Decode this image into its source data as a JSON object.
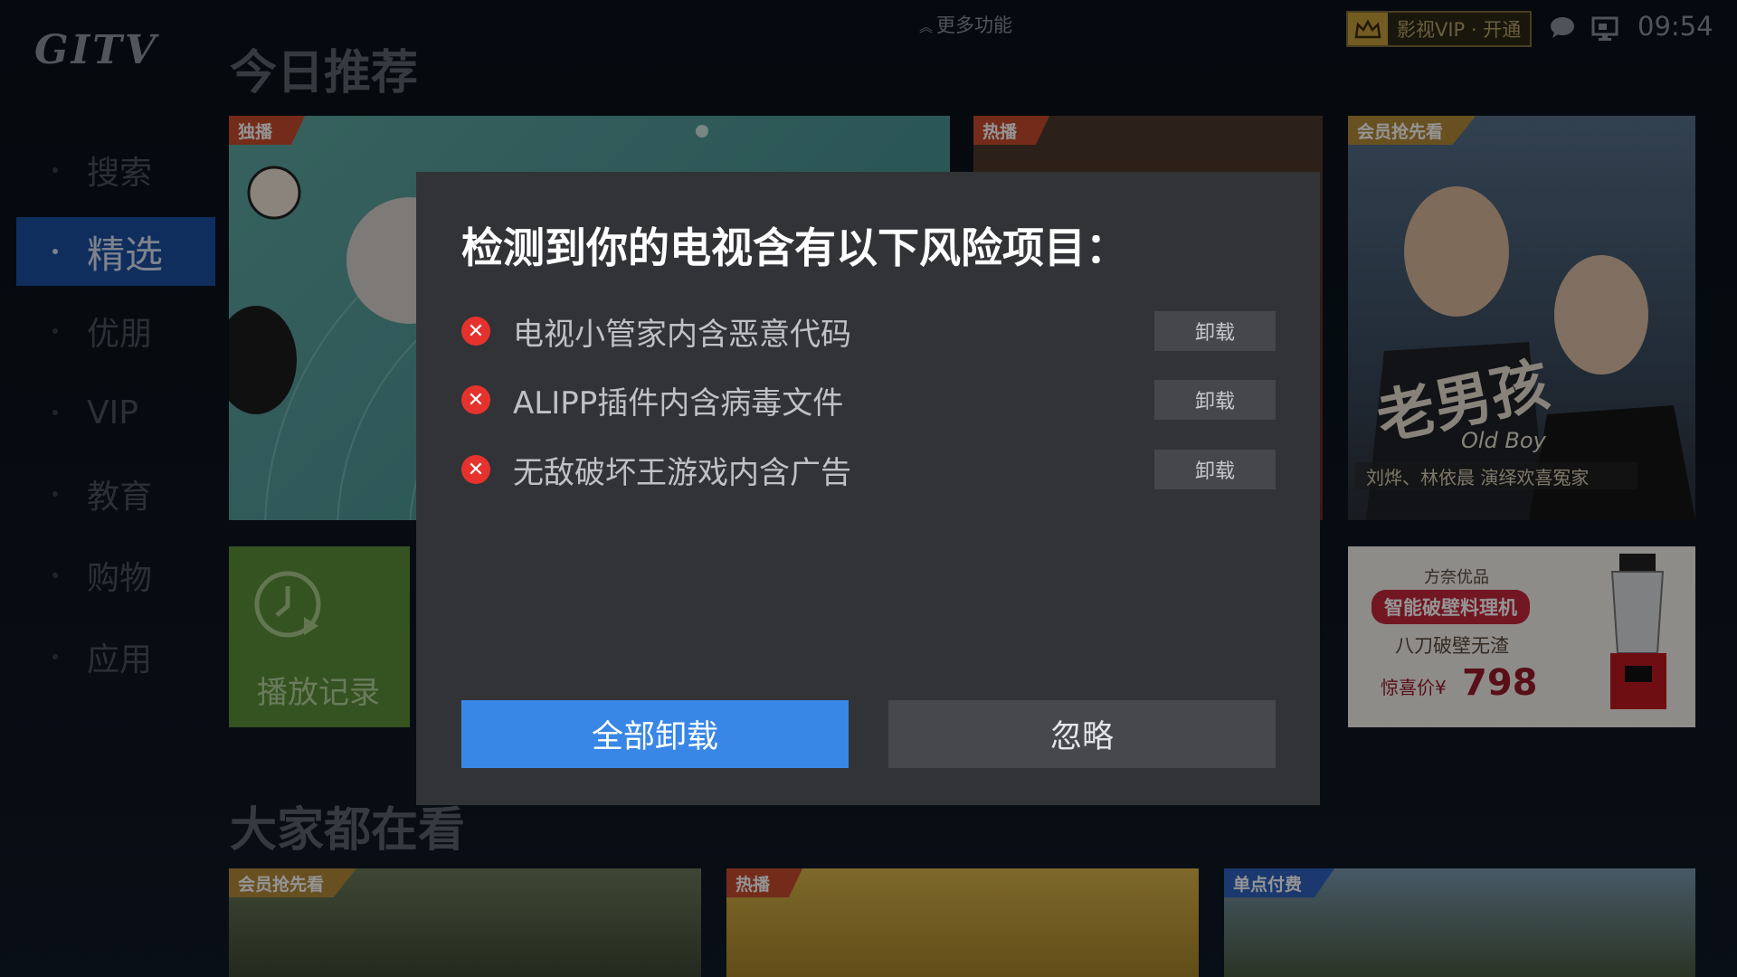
{
  "topbar": {
    "logo": "GITV",
    "more": "更多功能",
    "vip_label": "影视VIP · 开通",
    "clock": "09:54"
  },
  "sidebar": {
    "items": [
      {
        "label": "搜索",
        "active": false
      },
      {
        "label": "精选",
        "active": true
      },
      {
        "label": "优朋",
        "active": false
      },
      {
        "label": "VIP",
        "active": false
      },
      {
        "label": "教育",
        "active": false
      },
      {
        "label": "购物",
        "active": false
      },
      {
        "label": "应用",
        "active": false
      }
    ]
  },
  "sections": {
    "today": "今日推荐",
    "popular": "大家都在看"
  },
  "tiles": {
    "t1_tag": "独播",
    "t2_tag": "热播",
    "t3_tag": "会员抢先看",
    "t3_title": "老男孩",
    "t3_subtitle": "Old Boy",
    "t3_caption": "刘烨、林依晨 演绎欢喜冤家",
    "history": "播放记录",
    "ad_brand": "方奈优品",
    "ad_product": "智能破壁料理机",
    "ad_feature": "八刀破壁无渣",
    "ad_price_label": "惊喜价¥",
    "ad_price": "798",
    "b1_tag": "会员抢先看",
    "b2_tag": "热播",
    "b3_tag": "单点付费"
  },
  "dialog": {
    "title": "检测到你的电视含有以下风险项目：",
    "items": [
      {
        "label": "电视小管家内含恶意代码",
        "action": "卸载"
      },
      {
        "label": "ALIPP插件内含病毒文件",
        "action": "卸载"
      },
      {
        "label": "无敌破坏王游戏内含广告",
        "action": "卸载"
      }
    ],
    "uninstall_all": "全部卸载",
    "ignore": "忽略"
  },
  "colors": {
    "primary_button": "#3887e6",
    "danger_icon": "#e5322d",
    "nav_active": "#1b4fa0",
    "dialog_bg": "#323336"
  }
}
